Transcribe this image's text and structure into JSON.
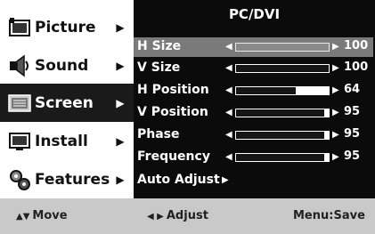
{
  "menu": {
    "items": [
      {
        "label": "Picture",
        "arrow": "▶",
        "icon": "picture-icon"
      },
      {
        "label": "Sound",
        "arrow": "▶",
        "icon": "sound-icon"
      },
      {
        "label": "Screen",
        "arrow": "▶",
        "icon": "screen-icon"
      },
      {
        "label": "Install",
        "arrow": "▶",
        "icon": "install-icon"
      },
      {
        "label": "Features",
        "arrow": "▶",
        "icon": "features-icon"
      }
    ],
    "selected": "Screen"
  },
  "panel": {
    "title": "PC/DVI",
    "rows": [
      {
        "label": "H Size",
        "value": "100",
        "level": 1.0,
        "highlighted": true
      },
      {
        "label": "V Size",
        "value": "100",
        "level": 1.0
      },
      {
        "label": "H Position",
        "value": "64",
        "level": 0.64
      },
      {
        "label": "V Position",
        "value": "95",
        "level": 0.95
      },
      {
        "label": "Phase",
        "value": "95",
        "level": 0.95
      },
      {
        "label": "Frequency",
        "value": "95",
        "level": 0.95
      }
    ],
    "auto_adjust": "Auto Adjust",
    "left_arrow": "◀",
    "right_arrow": "▶"
  },
  "footer": {
    "move_symbols": "▲▼",
    "move_label": "Move",
    "adjust_symbols": "◀ ▶",
    "adjust_label": "Adjust",
    "save_label": "Menu:Save"
  },
  "colors": {
    "panel_bg": "#0b0b0b",
    "selected_bg": "#1a1a1a",
    "highlight_bg": "#7a7a7a",
    "footer_bg": "#c9c9c9"
  }
}
